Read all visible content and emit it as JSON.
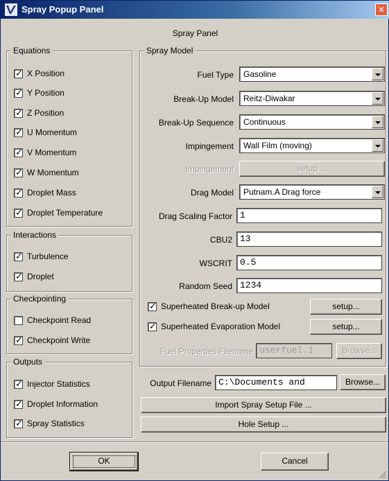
{
  "window": {
    "title": "Spray Popup Panel",
    "close_glyph": "✕"
  },
  "panel_heading": "Spray Panel",
  "equations": {
    "label": "Equations",
    "items": [
      {
        "label": "X Position",
        "checked": true
      },
      {
        "label": "Y Position",
        "checked": true
      },
      {
        "label": "Z Position",
        "checked": true
      },
      {
        "label": "U Momentum",
        "checked": true
      },
      {
        "label": "V Momentum",
        "checked": true
      },
      {
        "label": "W Momentum",
        "checked": true
      },
      {
        "label": "Droplet Mass",
        "checked": true
      },
      {
        "label": "Droplet Temperature",
        "checked": true
      }
    ]
  },
  "interactions": {
    "label": "Interactions",
    "items": [
      {
        "label": "Turbulence",
        "checked": true
      },
      {
        "label": "Droplet",
        "checked": true
      }
    ]
  },
  "checkpointing": {
    "label": "Checkpointing",
    "items": [
      {
        "label": "Checkpoint Read",
        "checked": false
      },
      {
        "label": "Checkpoint Write",
        "checked": true
      }
    ]
  },
  "outputs": {
    "label": "Outputs",
    "items": [
      {
        "label": "Injector Statistics",
        "checked": true
      },
      {
        "label": "Droplet Information",
        "checked": true
      },
      {
        "label": "Spray Statistics",
        "checked": true
      }
    ]
  },
  "spray_model": {
    "label": "Spray Model",
    "fuel_type": {
      "label": "Fuel Type",
      "value": "Gasoline"
    },
    "breakup_model": {
      "label": "Break-Up Model",
      "value": "Reitz-Diwakar"
    },
    "breakup_sequence": {
      "label": "Break-Up Sequence",
      "value": "Continuous"
    },
    "impingement": {
      "label": "Impingement",
      "value": "Wall Film (moving)"
    },
    "impingement_setup": {
      "label": "Impingement",
      "button": "setup ..."
    },
    "drag_model": {
      "label": "Drag Model",
      "value": "Putnam.A Drag force"
    },
    "drag_scaling": {
      "label": "Drag Scaling Factor",
      "value": "1"
    },
    "cbu2": {
      "label": "CBU2",
      "value": "13"
    },
    "wscrit": {
      "label": "WSCRIT",
      "value": "0.5"
    },
    "random_seed": {
      "label": "Random Seed",
      "value": "1234"
    },
    "superheated_breakup": {
      "label": "Superheated Break-up Model",
      "checked": true,
      "button": "setup..."
    },
    "superheated_evap": {
      "label": "Superheated Evaporation Model",
      "checked": true,
      "button": "setup..."
    },
    "fuel_properties": {
      "label": "Fuel Properties Filename",
      "value": "userfuel.1",
      "button": "Browse..."
    }
  },
  "output_filename": {
    "label": "Output Filename",
    "value": "C:\\Documents and",
    "button": "Browse..."
  },
  "import_button": "Import Spray Setup File ...",
  "hole_setup_button": "Hole Setup ...",
  "ok_button": "OK",
  "cancel_button": "Cancel"
}
